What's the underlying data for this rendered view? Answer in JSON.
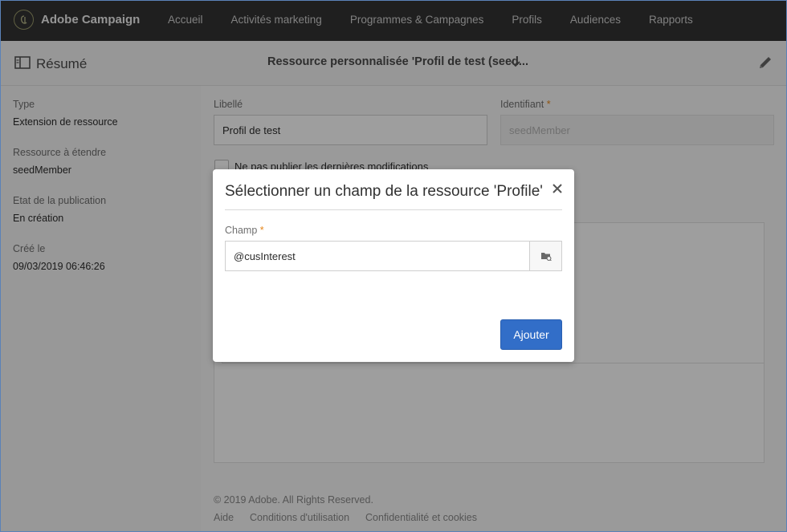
{
  "app": {
    "title": "Adobe Campaign"
  },
  "nav": {
    "items": [
      "Accueil",
      "Activités marketing",
      "Programmes & Campagnes",
      "Profils",
      "Audiences",
      "Rapports"
    ]
  },
  "subheader": {
    "resume": "Résumé",
    "resource_title": "Ressource personnalisée 'Profil de test (seed..."
  },
  "summary": {
    "type_label": "Type",
    "type_value": "Extension de ressource",
    "resource_label": "Ressource à étendre",
    "resource_value": "seedMember",
    "state_label": "Etat de la publication",
    "state_value": "En création",
    "created_label": "Créé le",
    "created_value": "09/03/2019 06:46:26"
  },
  "form": {
    "libelle_label": "Libellé",
    "libelle_value": "Profil de test",
    "identifiant_label": "Identifiant",
    "identifiant_required": "*",
    "identifiant_value": "seedMember",
    "checkbox_label": "Ne pas publier les dernières modifications"
  },
  "footer": {
    "copyright": "© 2019 Adobe. All Rights Reserved.",
    "links": [
      "Aide",
      "Conditions d'utilisation",
      "Confidentialité et cookies"
    ]
  },
  "modal": {
    "title": "Sélectionner un champ de la ressource 'Profile'",
    "field_label": "Champ",
    "field_required": "*",
    "field_value": "@cusInterest",
    "add_button": "Ajouter"
  },
  "colors": {
    "topbar": "#323232",
    "accent": "#326ec8",
    "required": "#e68619"
  },
  "icons": {
    "logo": "adobe-campaign-logo-icon",
    "resume": "summary-panel-icon",
    "chevron": "chevron-down-icon",
    "edit": "pencil-icon",
    "close": "close-icon",
    "picker": "folder-picker-icon"
  }
}
